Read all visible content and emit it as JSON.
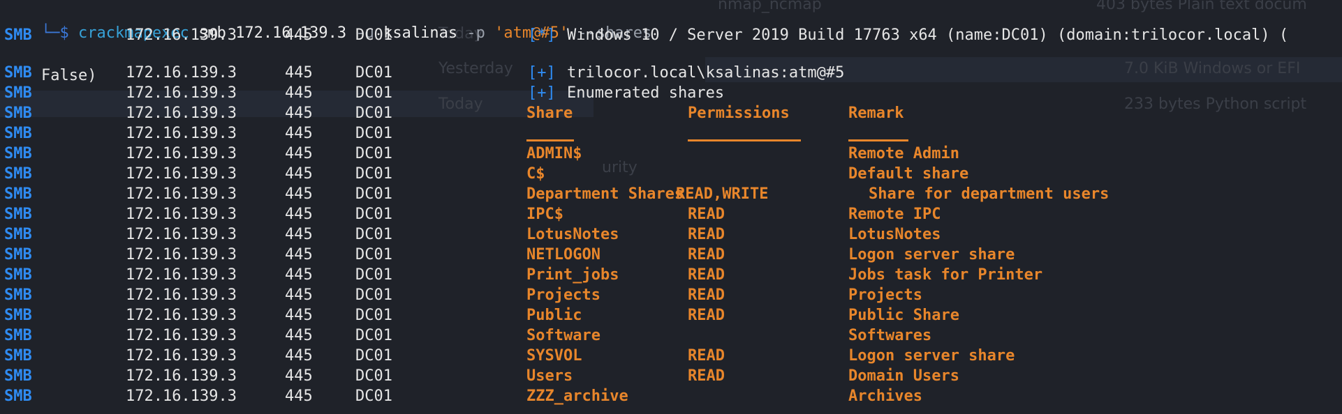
{
  "command": {
    "corner": "└─$",
    "tool": "crackmapexec",
    "proto": "smb",
    "target": "172.16.139.3",
    "user_flag": "-u",
    "user": "ksalinas",
    "pass_flag": "-p",
    "password": "'atm@#5'",
    "option": "--shares"
  },
  "rows_meta": {
    "protocol": "SMB",
    "ip": "172.16.139.3",
    "port": "445",
    "host": "DC01"
  },
  "info": {
    "marker": "[*]",
    "text": "Windows 10 / Server 2019 Build 17763 x64 (name:DC01) (domain:trilocor.local) (",
    "wrap": "False)"
  },
  "auth": {
    "marker": "[+]",
    "text": "trilocor.local\\ksalinas:atm@#5"
  },
  "enum": {
    "marker": "[+]",
    "text": "Enumerated shares"
  },
  "table": {
    "headers": [
      "Share",
      "Permissions",
      "Remark"
    ],
    "dashes": [
      "-----",
      "-----------",
      "------"
    ],
    "rows": [
      {
        "share": "ADMIN$",
        "perm": "",
        "remark": "Remote Admin"
      },
      {
        "share": "C$",
        "perm": "",
        "remark": "Default share"
      },
      {
        "share": "Department Shares",
        "perm": "READ,WRITE",
        "remark": "Share for department users"
      },
      {
        "share": "IPC$",
        "perm": "READ",
        "remark": "Remote IPC"
      },
      {
        "share": "LotusNotes",
        "perm": "READ",
        "remark": "LotusNotes"
      },
      {
        "share": "NETLOGON",
        "perm": "READ",
        "remark": "Logon server share"
      },
      {
        "share": "Print_jobs",
        "perm": "READ",
        "remark": "Jobs task for Printer"
      },
      {
        "share": "Projects",
        "perm": "READ",
        "remark": "Projects"
      },
      {
        "share": "Public",
        "perm": "READ",
        "remark": "Public Share"
      },
      {
        "share": "Software",
        "perm": "",
        "remark": "Softwares"
      },
      {
        "share": "SYSVOL",
        "perm": "READ",
        "remark": "Logon server share"
      },
      {
        "share": "Users",
        "perm": "READ",
        "remark": "Domain Users"
      },
      {
        "share": "ZZZ_archive",
        "perm": "",
        "remark": "Archives"
      }
    ]
  },
  "background_window": {
    "texts": [
      "Today",
      "Yesterday",
      "Today",
      "nmap_ncmap",
      "403 bytes Plain text docum",
      "7.0 KiB Windows or EFI",
      "233 bytes Python script",
      "urity"
    ]
  },
  "colors": {
    "background": "#1f2229",
    "smb_blue": "#2f8cf3",
    "orange": "#e8862b",
    "text": "#e6e6e6"
  }
}
